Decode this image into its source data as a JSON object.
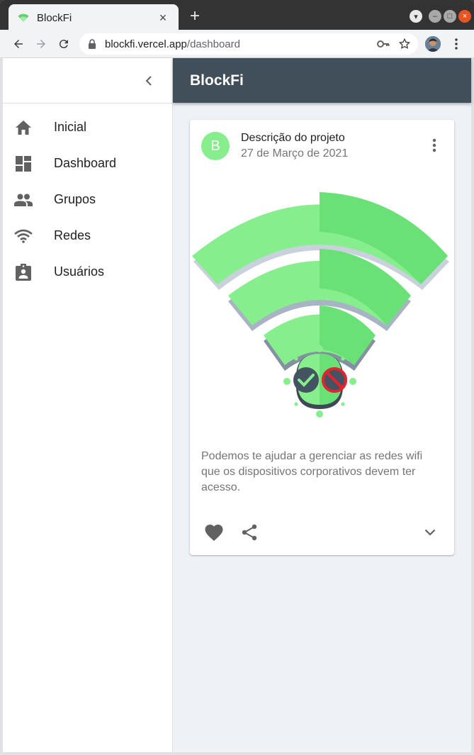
{
  "browser": {
    "tab_title": "BlockFi",
    "url_host": "blockfi.vercel.app",
    "url_path": "/dashboard",
    "icons": [
      "wifi-favicon-icon",
      "close-icon",
      "plus-icon",
      "back-icon",
      "forward-icon",
      "reload-icon",
      "lock-icon",
      "key-icon",
      "star-icon",
      "kebab-menu-icon"
    ]
  },
  "sidebar": {
    "items": [
      {
        "label": "Inicial",
        "icon": "home-icon"
      },
      {
        "label": "Dashboard",
        "icon": "dashboard-icon"
      },
      {
        "label": "Grupos",
        "icon": "people-icon"
      },
      {
        "label": "Redes",
        "icon": "wifi-icon"
      },
      {
        "label": "Usuários",
        "icon": "assignment-ind-icon"
      }
    ]
  },
  "appbar": {
    "title": "BlockFi",
    "color": "#404f5a"
  },
  "card": {
    "avatar_letter": "B",
    "title": "Descrição do projeto",
    "subheader": "27 de Março de 2021",
    "description": "Podemos te ajudar a gerenciar as redes wifi que os dispositivos corporativos devem ter acesso.",
    "accent_color": "#86ee8d"
  }
}
